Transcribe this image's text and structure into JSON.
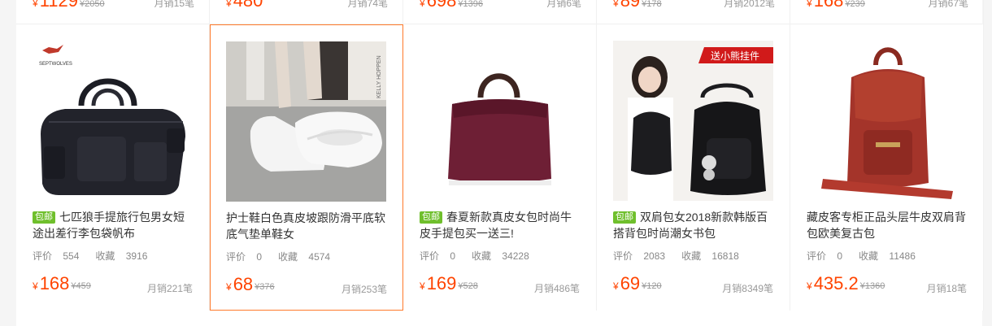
{
  "prev_row": [
    {
      "price": "1129",
      "orig": "¥2050",
      "sales": "月销15笔"
    },
    {
      "price": "480",
      "orig": "",
      "sales": "月销74笔"
    },
    {
      "price": "698",
      "orig": "¥1396",
      "sales": "月销6笔"
    },
    {
      "price": "89",
      "orig": "¥178",
      "sales": "月销2012笔"
    },
    {
      "price": "168",
      "orig": "¥239",
      "sales": "月销67笔"
    }
  ],
  "products": [
    {
      "tag": "包邮",
      "title": "七匹狼手提旅行包男女短途出差行李包袋帆布",
      "reviews_label": "评价",
      "reviews": "554",
      "fav_label": "收藏",
      "favs": "3916",
      "yen": "¥",
      "price": "168",
      "orig": "¥459",
      "sales": "月销221笔",
      "brand": "SEPTWOLVES"
    },
    {
      "tag": "",
      "title": "护士鞋白色真皮坡跟防滑平底软底气垫单鞋女",
      "reviews_label": "评价",
      "reviews": "0",
      "fav_label": "收藏",
      "favs": "4574",
      "yen": "¥",
      "price": "68",
      "orig": "¥376",
      "sales": "月销253笔",
      "book_text": "KELLY HOPPEN"
    },
    {
      "tag": "包邮",
      "title": "春夏新款真皮女包时尚牛皮手提包买一送三!",
      "reviews_label": "评价",
      "reviews": "0",
      "fav_label": "收藏",
      "favs": "34228",
      "yen": "¥",
      "price": "169",
      "orig": "¥528",
      "sales": "月销486笔"
    },
    {
      "tag": "包邮",
      "title": "双肩包女2018新款韩版百搭背包时尚潮女书包",
      "reviews_label": "评价",
      "reviews": "2083",
      "fav_label": "收藏",
      "favs": "16818",
      "yen": "¥",
      "price": "69",
      "orig": "¥120",
      "sales": "月销8349笔",
      "promo": "送小熊挂件"
    },
    {
      "tag": "",
      "title": "藏皮客专柜正品头层牛皮双肩背包欧美复古包",
      "reviews_label": "评价",
      "reviews": "0",
      "fav_label": "收藏",
      "favs": "11486",
      "yen": "¥",
      "price": "435.2",
      "orig": "¥1360",
      "sales": "月销18笔"
    }
  ],
  "colors": {
    "price": "#ff4400",
    "tag": "#6fbf2c",
    "hover_border": "#ff7a2b"
  }
}
